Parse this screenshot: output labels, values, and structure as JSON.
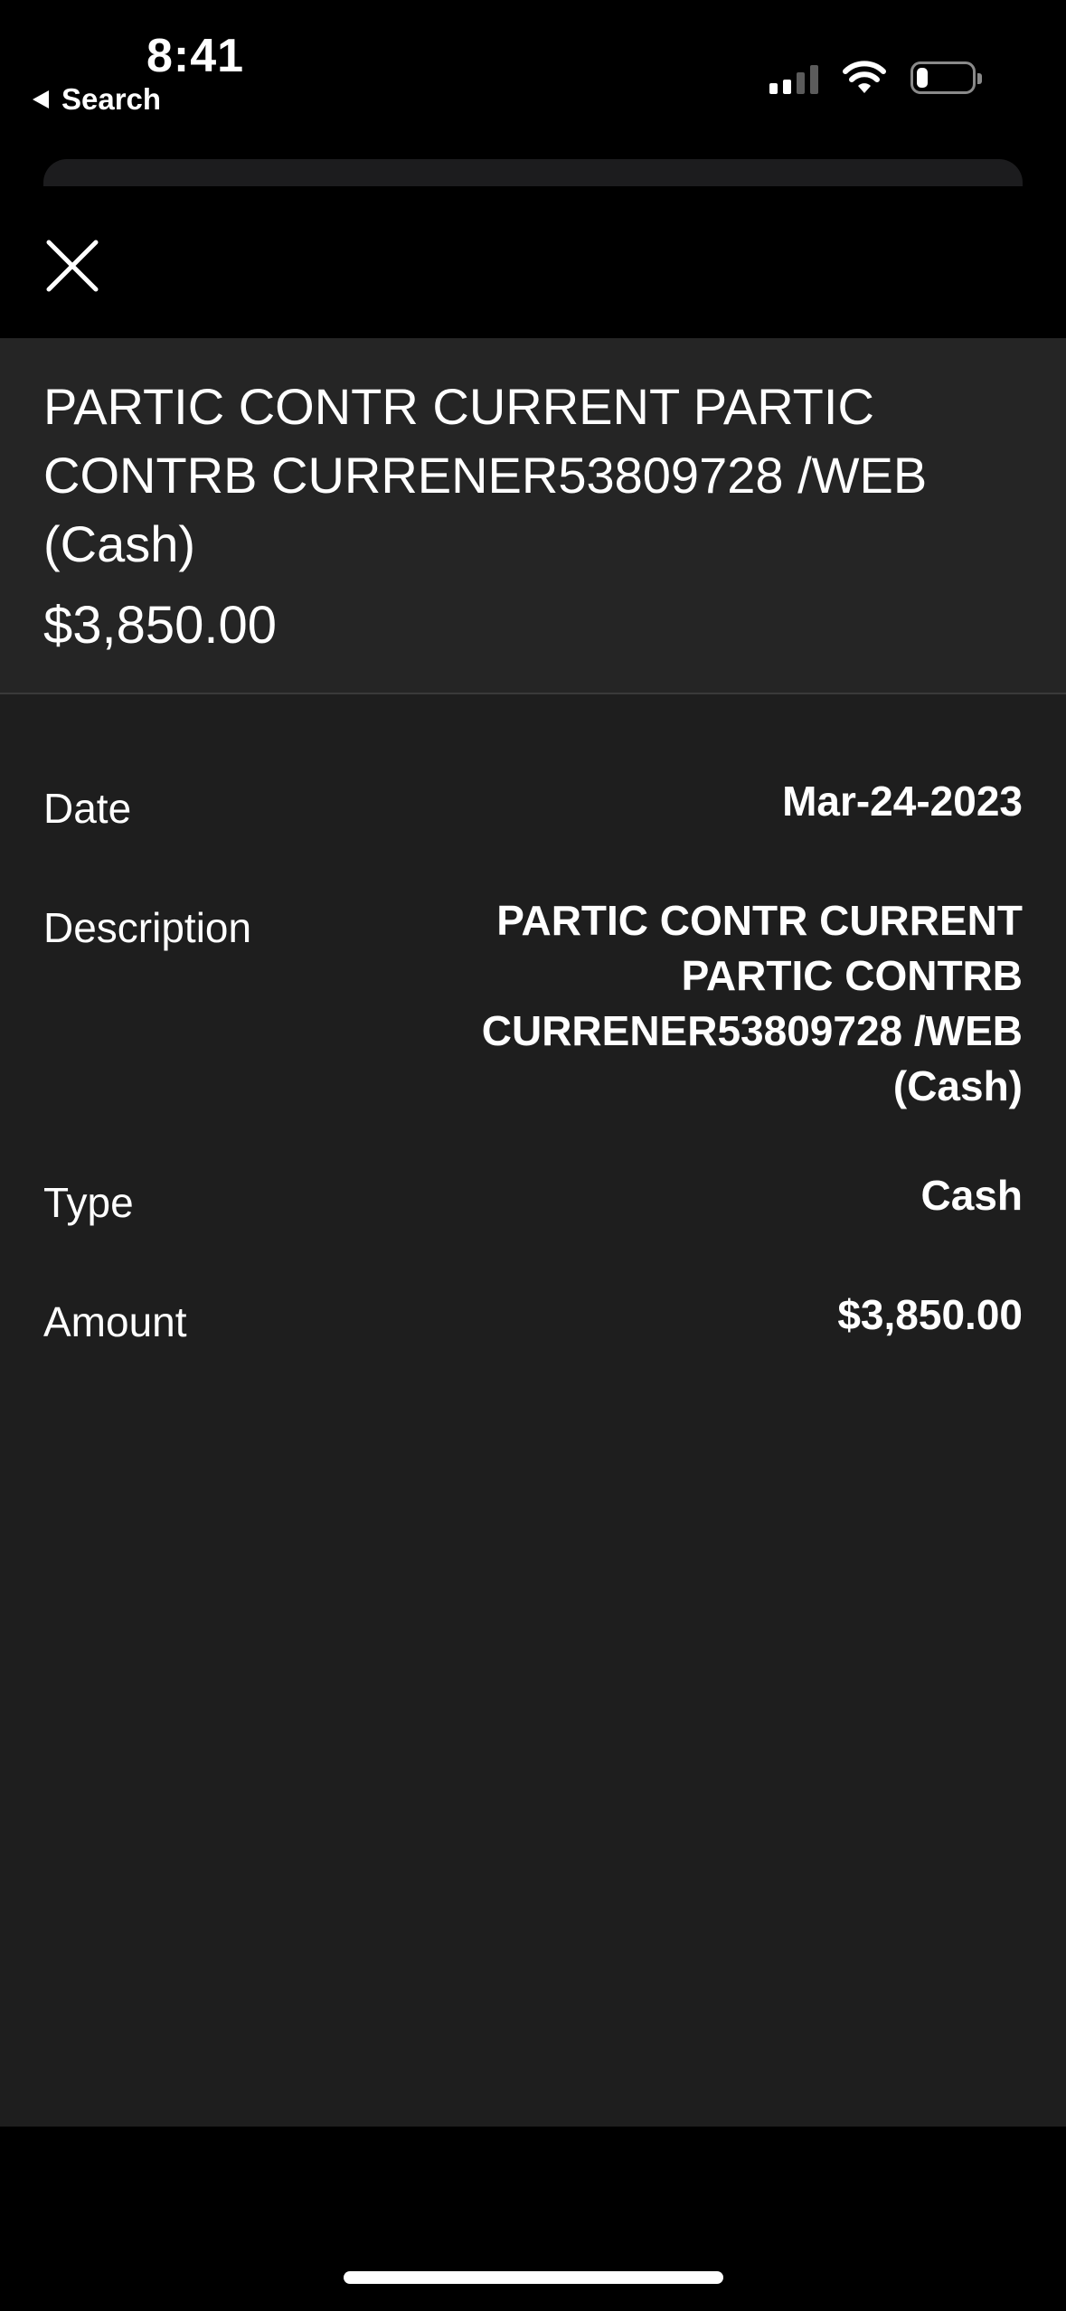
{
  "status_bar": {
    "time": "8:41",
    "back_label": "Search",
    "battery_level": 0.2
  },
  "modal": {
    "close_icon": "close-icon",
    "title": "PARTIC CONTR CURRENT PARTIC CONTRB CURRENER53809728 /WEB (Cash)",
    "amount": "$3,850.00"
  },
  "details": {
    "date": {
      "label": "Date",
      "value": "Mar-24-2023"
    },
    "description": {
      "label": "Description",
      "value": "PARTIC CONTR CURRENT PARTIC CONTRB CURRENER53809728 /WEB (Cash)"
    },
    "type": {
      "label": "Type",
      "value": "Cash"
    },
    "amount": {
      "label": "Amount",
      "value": "$3,850.00"
    }
  },
  "colors": {
    "background": "#000000",
    "title_band": "#252525",
    "details_background": "#1e1e1e",
    "text": "#ffffff"
  }
}
